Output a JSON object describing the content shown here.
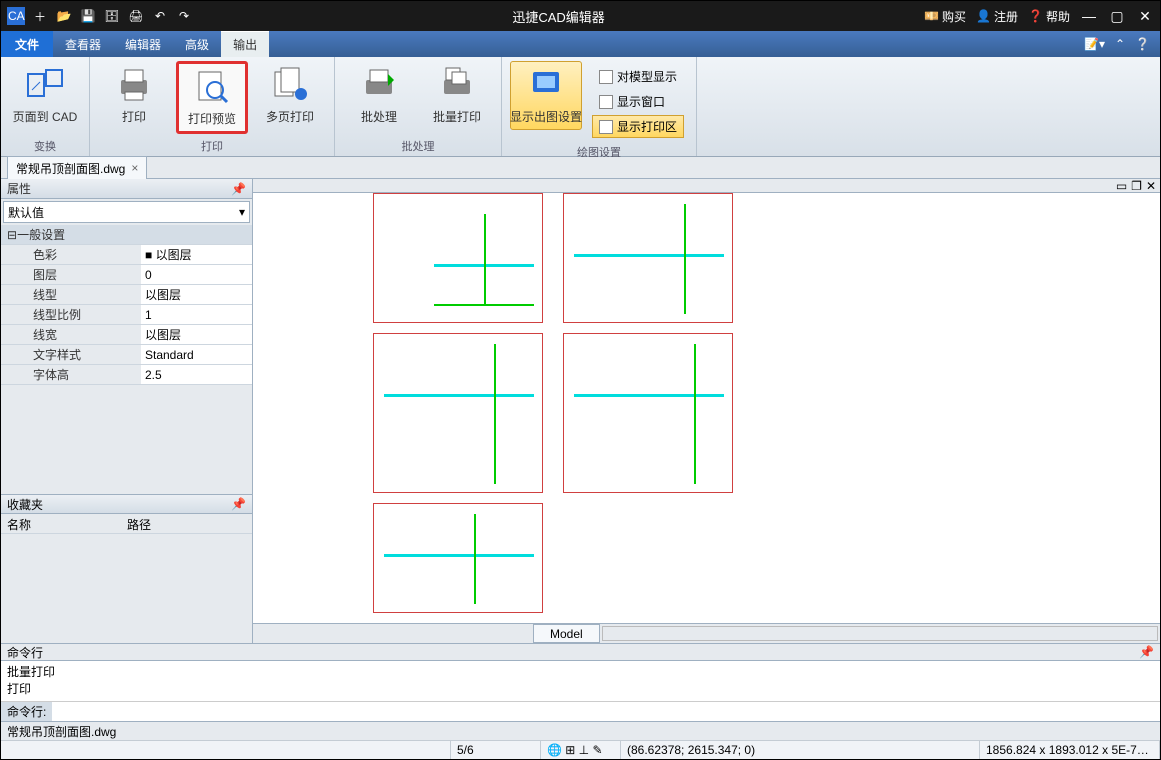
{
  "titlebar": {
    "title": "迅捷CAD编辑器",
    "buy": "购买",
    "register": "注册",
    "help": "帮助"
  },
  "menubar": {
    "file": "文件",
    "tabs": [
      "查看器",
      "编辑器",
      "高级",
      "输出"
    ]
  },
  "ribbon": {
    "group1": {
      "label": "变换",
      "btn1": "页面到 CAD"
    },
    "group2": {
      "label": "打印",
      "btn1": "打印",
      "btn2": "打印预览",
      "btn3": "多页打印"
    },
    "group3": {
      "label": "批处理",
      "btn1": "批处理",
      "btn2": "批量打印"
    },
    "group4": {
      "label": "绘图设置",
      "btn1": "显示出图设置",
      "chk1": "对模型显示",
      "chk2": "显示窗口",
      "chk3": "显示打印区"
    }
  },
  "doctab": {
    "name": "常规吊顶剖面图.dwg"
  },
  "props": {
    "title": "属性",
    "selector": "默认值",
    "groupheader": "一般设置",
    "rows": [
      {
        "k": "色彩",
        "v": "■ 以图层"
      },
      {
        "k": "图层",
        "v": "0"
      },
      {
        "k": "线型",
        "v": "以图层"
      },
      {
        "k": "线型比例",
        "v": "1"
      },
      {
        "k": "线宽",
        "v": "以图层"
      },
      {
        "k": "文字样式",
        "v": "Standard"
      },
      {
        "k": "字体高",
        "v": "2.5"
      }
    ]
  },
  "fav": {
    "title": "收藏夹",
    "col1": "名称",
    "col2": "路径"
  },
  "model": {
    "tab": "Model"
  },
  "cmd": {
    "title": "命令行",
    "out": "批量打印\n打印",
    "prompt": "命令行:"
  },
  "status": {
    "file": "常规吊顶剖面图.dwg",
    "pages": "5/6",
    "coords": "(86.62378; 2615.347; 0)",
    "dim": "1856.824 x 1893.012 x 5E-7…"
  }
}
